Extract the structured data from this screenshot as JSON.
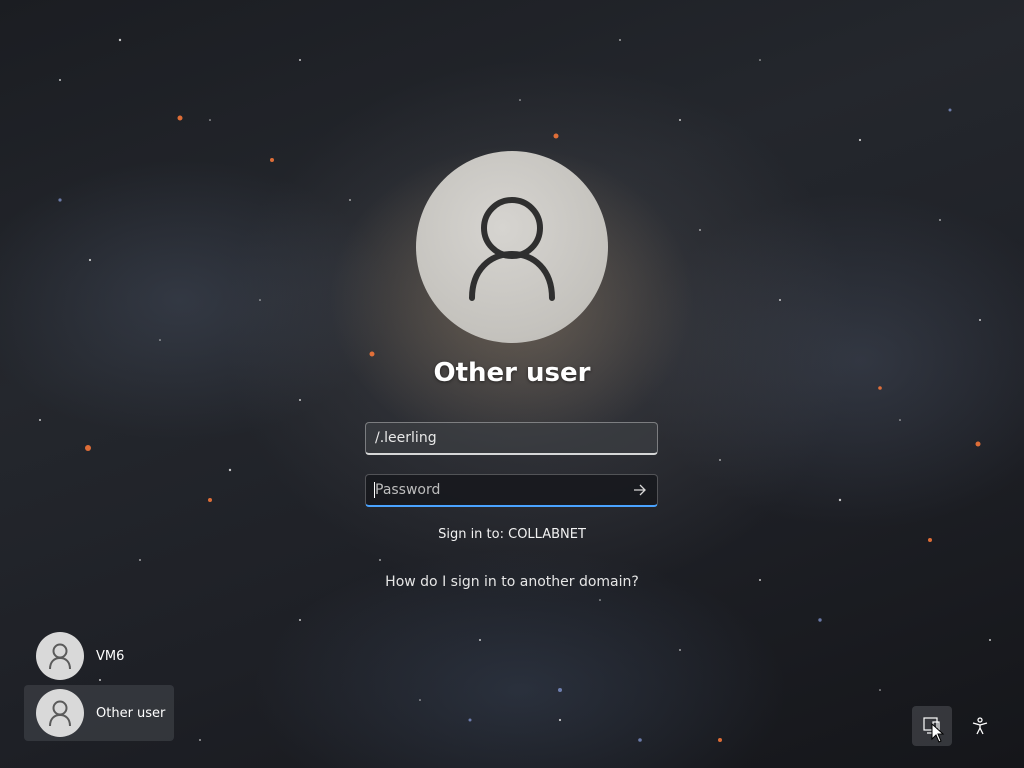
{
  "login": {
    "user_title": "Other user",
    "username_value": "/.leerling",
    "password_placeholder": "Password",
    "sign_in_to": "Sign in to: COLLABNET",
    "other_domain_link": "How do I sign in to another domain?"
  },
  "user_list": [
    {
      "label": "VM6",
      "selected": false
    },
    {
      "label": "Other user",
      "selected": true
    }
  ],
  "corner_buttons": {
    "network_icon": "network-icon",
    "accessibility_icon": "accessibility-icon"
  },
  "colors": {
    "focus_accent": "#4aa3ff",
    "avatar_bg": "#c4c2bd"
  }
}
